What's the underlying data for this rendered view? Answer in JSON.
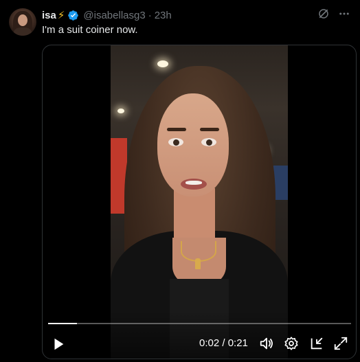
{
  "tweet": {
    "author_name": "isa",
    "author_emoji": "⚡",
    "verified": true,
    "handle": "@isabellasg3",
    "separator": "·",
    "time": "23h",
    "text": "I'm a suit coiner now.",
    "icons": [
      "grok-icon",
      "more-icon"
    ]
  },
  "video": {
    "current_time": "0:02",
    "duration": "0:21",
    "time_display": "0:02 / 0:21",
    "progress_fraction": 0.095,
    "controls": [
      "play-icon",
      "volume-icon",
      "settings-icon",
      "pip-icon",
      "fullscreen-icon"
    ]
  },
  "colors": {
    "background": "#000000",
    "text_primary": "#e7e9ea",
    "text_secondary": "#71767b",
    "verified_blue": "#1d9bf0",
    "bolt_yellow": "#f7c52b"
  }
}
